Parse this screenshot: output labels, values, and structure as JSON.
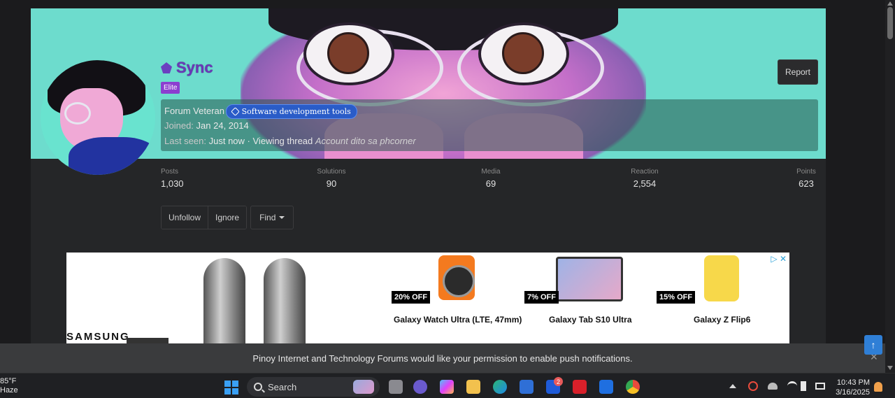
{
  "profile": {
    "username": "Sync",
    "badge": "Elite",
    "title": "Forum Veteran",
    "tag": "Software development tools",
    "joined_label": "Joined:",
    "joined_value": "Jan 24, 2014",
    "lastseen_label": "Last seen:",
    "lastseen_value": "Just now",
    "activity": " · Viewing thread",
    "activity_detail": "Account dito sa phcorner",
    "report_label": "Report"
  },
  "stats": [
    {
      "label": "Posts",
      "value": "1,030"
    },
    {
      "label": "Solutions",
      "value": "90"
    },
    {
      "label": "Media",
      "value": "69"
    },
    {
      "label": "Reaction",
      "value": "2,554"
    },
    {
      "label": "Points",
      "value": "623"
    }
  ],
  "actions": {
    "unfollow": "Unfollow",
    "ignore": "Ignore",
    "find": "Find"
  },
  "ad": {
    "brand": "SAMSUNG",
    "products": [
      {
        "name": "Galaxy Watch Ultra (LTE, 47mm)",
        "discount": "20% OFF"
      },
      {
        "name": "Galaxy Tab S10 Ultra",
        "discount": "7% OFF"
      },
      {
        "name": "Galaxy Z Flip6",
        "discount": "15% OFF"
      }
    ],
    "adchoices": "▷ ✕"
  },
  "push_notice": "Pinoy Internet and Technology Forums would like your permission to enable push notifications.",
  "push_close": "✕",
  "scroll_top": "↑",
  "taskbar": {
    "temperature": "85°F",
    "weather": "Haze",
    "search_label": "Search",
    "badge_count": "2",
    "time": "10:43 PM",
    "date": "3/16/2025"
  },
  "colors": {
    "accent_username": "#6a38b8",
    "badge_elite": "#8c3ed0",
    "tag_chip": "#2a5cc8"
  }
}
